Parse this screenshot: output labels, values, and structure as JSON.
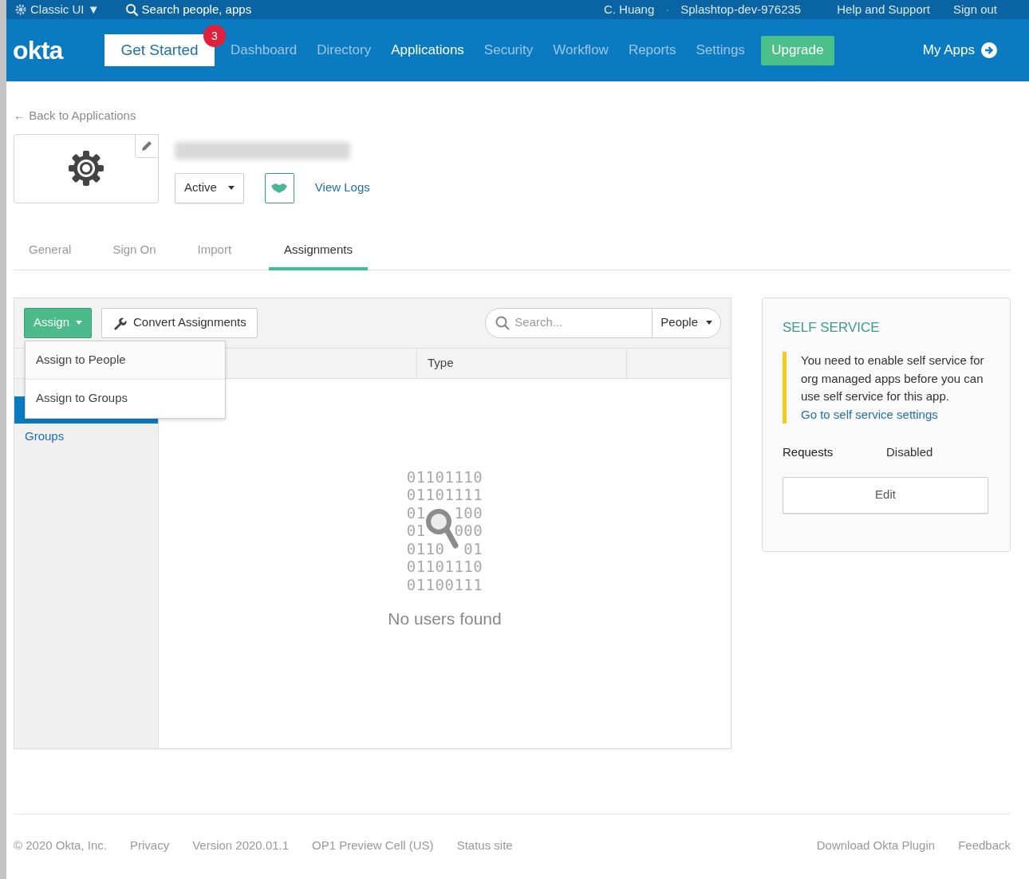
{
  "top_bar": {
    "classic_ui": "Classic UI ▼",
    "search": "Search people, apps",
    "user": "C. Huang",
    "separator": "·",
    "org": "Splashtop-dev-976235",
    "links": [
      "Help and Support",
      "Sign out"
    ]
  },
  "nav": {
    "logo": "okta",
    "get_started": "Get Started",
    "badge": "3",
    "items": [
      {
        "label": "Dashboard",
        "selected": false
      },
      {
        "label": "Directory",
        "selected": false
      },
      {
        "label": "Applications",
        "selected": true
      },
      {
        "label": "Security",
        "selected": false
      },
      {
        "label": "Workflow",
        "selected": false
      },
      {
        "label": "Reports",
        "selected": false
      },
      {
        "label": "Settings",
        "selected": false
      }
    ],
    "upgrade": "Upgrade",
    "my_apps": "My Apps"
  },
  "back_link": "← Back to Applications",
  "app": {
    "status": "Active",
    "view_logs": "View Logs"
  },
  "tabs": [
    {
      "label": "General",
      "selected": false
    },
    {
      "label": "Sign On",
      "selected": false
    },
    {
      "label": "Import",
      "selected": false
    },
    {
      "label": "Assignments",
      "selected": true
    }
  ],
  "toolbar": {
    "assign": "Assign",
    "convert": "Convert Assignments",
    "search_placeholder": "Search...",
    "filter": "People"
  },
  "assign_menu": [
    "Assign to People",
    "Assign to Groups"
  ],
  "table": {
    "columns": [
      "Type"
    ]
  },
  "filters": [
    {
      "selected": true
    },
    {
      "label": "Groups",
      "selected": false
    }
  ],
  "empty": {
    "binary": [
      "01101110",
      "01101111",
      "01   100",
      "01   000",
      "0110  01",
      "01101110",
      "01100111"
    ],
    "message": "No users found"
  },
  "self_service": {
    "title": "SELF SERVICE",
    "notice": "You need to enable self service for org managed apps before you can use self service for this app.",
    "notice_link": "Go to self service settings",
    "requests_label": "Requests",
    "requests_value": "Disabled",
    "edit": "Edit"
  },
  "footer": {
    "left": [
      "© 2020 Okta, Inc.",
      "Privacy",
      "Version 2020.01.1",
      "OP1 Preview Cell (US)",
      "Status site"
    ],
    "right": [
      "Download Okta Plugin",
      "Feedback"
    ]
  }
}
